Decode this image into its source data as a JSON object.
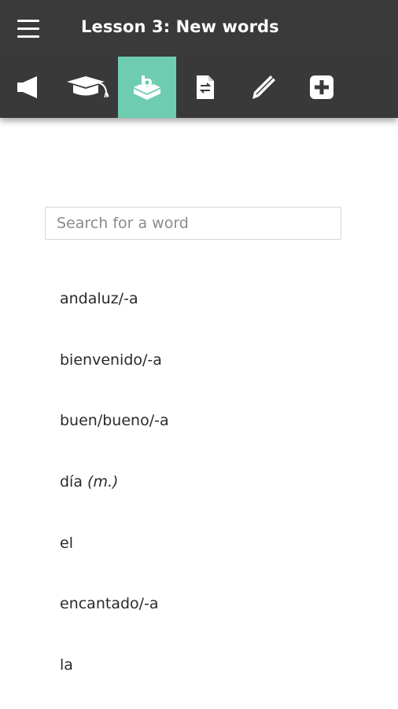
{
  "header": {
    "title": "Lesson 3: New words",
    "menu_icon": "hamburger-menu-icon"
  },
  "toolbar": {
    "active_color": "#6ecdb0",
    "buttons": [
      {
        "icon": "megaphone-icon",
        "active": false
      },
      {
        "icon": "graduation-cap-icon",
        "active": false
      },
      {
        "icon": "vocabulary-box-icon",
        "active": true
      },
      {
        "icon": "document-swap-icon",
        "active": false
      },
      {
        "icon": "pencil-icon",
        "active": false
      },
      {
        "icon": "plus-square-icon",
        "active": false
      }
    ]
  },
  "search": {
    "placeholder": "Search for a word",
    "value": ""
  },
  "words": [
    {
      "word": "andaluz/-a",
      "note": ""
    },
    {
      "word": "bienvenido/-a",
      "note": ""
    },
    {
      "word": "buen/bueno/-a",
      "note": ""
    },
    {
      "word": "día",
      "note": "(m.)"
    },
    {
      "word": "el",
      "note": ""
    },
    {
      "word": "encantado/-a",
      "note": ""
    },
    {
      "word": "la",
      "note": ""
    }
  ]
}
